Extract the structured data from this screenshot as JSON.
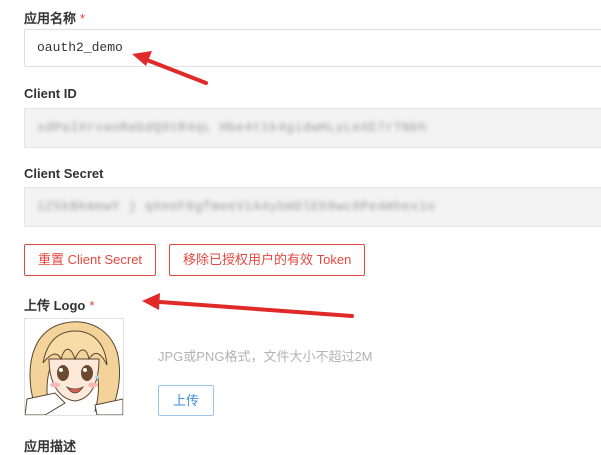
{
  "app_name": {
    "label": "应用名称",
    "required_mark": "*",
    "value": "oauth2_demo"
  },
  "client_id": {
    "label": "Client ID",
    "value": "xdPaIXrvaoRabdQ9tR4qL Hbe4t1k4gidwHLyLeXE7rTNbh"
  },
  "client_secret": {
    "label": "Client Secret",
    "value": "1Z5kBkmewY j qXeeF6gfmeeViA4ybmDlEb9wc8Pe4mhexio"
  },
  "actions": {
    "reset_secret_label": "重置 Client Secret",
    "remove_tokens_label": "移除已授权用户的有效 Token"
  },
  "logo": {
    "label": "上传 Logo",
    "required_mark": "*",
    "hint": "JPG或PNG格式，文件大小不超过2M",
    "upload_label": "上传",
    "image_icon": "anime-girl-avatar"
  },
  "description": {
    "label": "应用描述"
  },
  "colors": {
    "required": "#e23c3c",
    "danger_button": "#e5483f",
    "primary_button": "#3b8fd9",
    "annotation_arrow": "#e02a2a"
  }
}
